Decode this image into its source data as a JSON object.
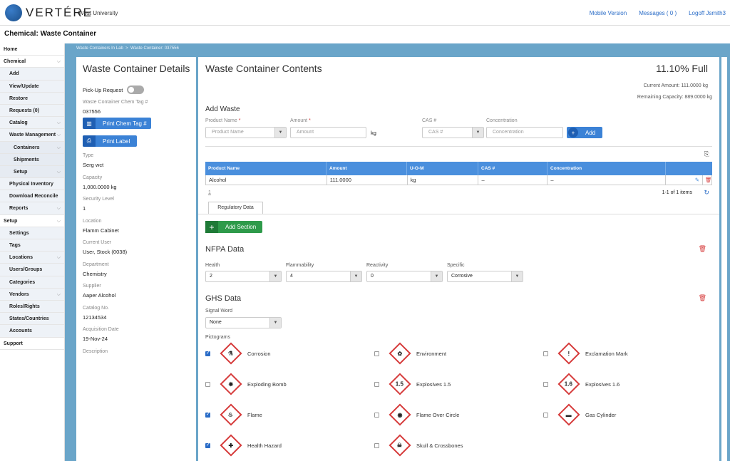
{
  "header": {
    "brand": "VERTÉRE",
    "university": "West University",
    "links": [
      "Mobile Version",
      "Messages ( 0 )",
      "Logoff Jsmith3"
    ]
  },
  "page_title": "Chemical: Waste Container",
  "sidebar": [
    {
      "label": "Home",
      "level": 0,
      "chev": false
    },
    {
      "label": "Chemical",
      "level": 0,
      "chev": true
    },
    {
      "label": "Add",
      "level": 1,
      "chev": false
    },
    {
      "label": "View/Update",
      "level": 1,
      "chev": false
    },
    {
      "label": "Restore",
      "level": 1,
      "chev": false
    },
    {
      "label": "Requests (0)",
      "level": 1,
      "chev": false
    },
    {
      "label": "Catalog",
      "level": 1,
      "chev": true
    },
    {
      "label": "Waste Management",
      "level": 1,
      "chev": true
    },
    {
      "label": "Containers",
      "level": 2,
      "chev": true
    },
    {
      "label": "Shipments",
      "level": 2,
      "chev": false
    },
    {
      "label": "Setup",
      "level": 2,
      "chev": true
    },
    {
      "label": "Physical Inventory",
      "level": 1,
      "chev": false
    },
    {
      "label": "Download Reconcile",
      "level": 1,
      "chev": false
    },
    {
      "label": "Reports",
      "level": 1,
      "chev": true
    },
    {
      "label": "Setup",
      "level": 0,
      "chev": true
    },
    {
      "label": "Settings",
      "level": 1,
      "chev": false
    },
    {
      "label": "Tags",
      "level": 1,
      "chev": false
    },
    {
      "label": "Locations",
      "level": 1,
      "chev": true
    },
    {
      "label": "Users/Groups",
      "level": 1,
      "chev": false
    },
    {
      "label": "Categories",
      "level": 1,
      "chev": false
    },
    {
      "label": "Vendors",
      "level": 1,
      "chev": true
    },
    {
      "label": "Roles/Rights",
      "level": 1,
      "chev": false
    },
    {
      "label": "States/Countries",
      "level": 1,
      "chev": false
    },
    {
      "label": "Accounts",
      "level": 1,
      "chev": false
    },
    {
      "label": "Support",
      "level": 0,
      "chev": false
    }
  ],
  "breadcrumb": {
    "first": "Waste Containers In Lab",
    "sep": ">",
    "second": "Waste Container: 037556"
  },
  "details": {
    "title": "Waste Container Details",
    "pickup_label": "Pick-Up Request",
    "tag_label": "Waste Container Chem Tag #",
    "tag_value": "037556",
    "print_chem_tag": "Print Chem Tag #",
    "print_label": "Print Label",
    "fields": [
      {
        "label": "Type",
        "value": "Serg wct"
      },
      {
        "label": "Capacity",
        "value": "1,000.0000 kg"
      },
      {
        "label": "Security Level",
        "value": "1"
      },
      {
        "label": "Location",
        "value": "Flamm Cabinet"
      },
      {
        "label": "Current User",
        "value": "User, Stock (0038)"
      },
      {
        "label": "Department",
        "value": "Chemistry"
      },
      {
        "label": "Supplier",
        "value": "Aaper Alcohol"
      },
      {
        "label": "Catalog No.",
        "value": "12134534"
      },
      {
        "label": "Acquisition Date",
        "value": "19-Nov-24"
      },
      {
        "label": "Description",
        "value": ""
      }
    ]
  },
  "contents": {
    "title": "Waste Container Contents",
    "full": "11.10% Full",
    "current_amount": "Current Amount: 111.0000 kg",
    "remaining": "Remaining Capacity: 889.0000 kg",
    "add_waste": "Add Waste",
    "product_label": "Product Name",
    "product_placeholder": "Product Name",
    "amount_label": "Amount",
    "amount_placeholder": "Amount",
    "unit": "kg",
    "cas_label": "CAS #",
    "cas_placeholder": "CAS #",
    "conc_label": "Concentration",
    "conc_placeholder": "Concentration",
    "add_button": "Add",
    "required": "*",
    "columns": [
      "Product Name",
      "Amount",
      "U-O-M",
      "CAS #",
      "Concentration"
    ],
    "rows": [
      [
        "Alcohol",
        "111.0000",
        "kg",
        "–",
        "–"
      ]
    ],
    "page": "1",
    "items": "1-1 of 1 items"
  },
  "regulatory": {
    "tab": "Regulatory Data",
    "add_section": "Add Section",
    "nfpa_title": "NFPA Data",
    "health_label": "Health",
    "health_value": "2",
    "flam_label": "Flammability",
    "flam_value": "4",
    "react_label": "Reactivity",
    "react_value": "0",
    "spec_label": "Specific",
    "spec_value": "Corrosive",
    "ghs_title": "GHS Data",
    "signal_label": "Signal Word",
    "signal_value": "None",
    "pictograms_label": "Pictograms",
    "pictograms": [
      {
        "label": "Corrosion",
        "checked": true,
        "glyph": "⚗"
      },
      {
        "label": "Environment",
        "checked": false,
        "glyph": "✿"
      },
      {
        "label": "Exclamation Mark",
        "checked": false,
        "glyph": "!"
      },
      {
        "label": "Exploding Bomb",
        "checked": false,
        "glyph": "✹"
      },
      {
        "label": "Explosives 1.5",
        "checked": false,
        "glyph": "1.5"
      },
      {
        "label": "Explosives 1.6",
        "checked": false,
        "glyph": "1.6"
      },
      {
        "label": "Flame",
        "checked": true,
        "glyph": "♨"
      },
      {
        "label": "Flame Over Circle",
        "checked": false,
        "glyph": "◉"
      },
      {
        "label": "Gas Cylinder",
        "checked": false,
        "glyph": "▬"
      },
      {
        "label": "Health Hazard",
        "checked": true,
        "glyph": "✚"
      },
      {
        "label": "Skull & Crossbones",
        "checked": false,
        "glyph": "☠"
      }
    ]
  },
  "colors": {
    "accent": "#3b82d6",
    "panel_bg": "#6aa5c9",
    "danger": "#d63b3b",
    "success": "#2e9a4a"
  }
}
